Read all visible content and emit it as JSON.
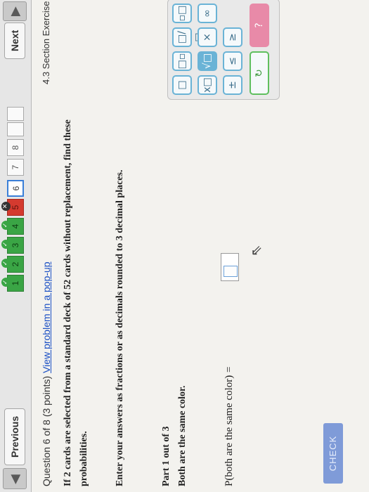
{
  "nav": {
    "prev_label": "Previous",
    "next_label": "Next",
    "back_arrow": "◀",
    "questions": [
      "1",
      "2",
      "3",
      "4",
      "5",
      "6",
      "7",
      "8"
    ],
    "check_glyph": "✓",
    "x_glyph": "✕"
  },
  "question": {
    "header_prefix": "Question 6 of 8 (3 points)",
    "popup_link": "View problem in a pop-up",
    "section": "4.3 Section Exercise",
    "prompt_line1": "If 2 cards are selected from a standard deck of 52 cards without replacement, find these",
    "prompt_line2": "probabilities.",
    "instructions": "Enter your answers as fractions or as decimals rounded to 3 decimal places."
  },
  "part": {
    "label": "Part 1 out of 3",
    "title": "Both are the same color.",
    "equation_label": "P(both are the same color) =",
    "answer_value": ""
  },
  "check_button_label": "CHECK",
  "palette": {
    "buttons": [
      "□",
      "□▫",
      "□/□",
      "▫□",
      "x□",
      "√□",
      "×",
      "∞",
      "±",
      "≤",
      "≥",
      "↻",
      "?"
    ]
  },
  "colors": {
    "correct": "#3aa545",
    "wrong": "#d43a2f",
    "current": "#3a7fd8",
    "link": "#1a4fc4",
    "check_button": "#7f9bd8"
  }
}
